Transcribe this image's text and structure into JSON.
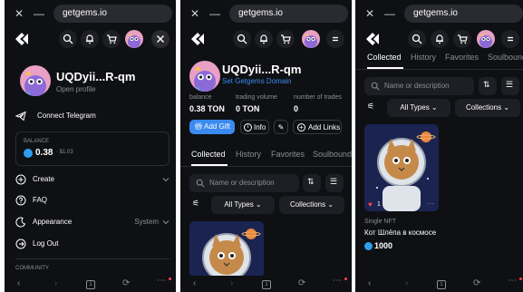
{
  "browser": {
    "url": "getgems.io"
  },
  "user": {
    "short_address": "UQDyii...R-qm",
    "open_profile": "Open profile",
    "set_domain": "Set Getgems Domain"
  },
  "menu": {
    "connect_telegram": "Connect Telegram",
    "balance_label": "BALANCE",
    "balance_value": "0.38",
    "balance_usd": "· $1.03",
    "items": [
      {
        "label": "Create",
        "icon": "plus-circle-icon"
      },
      {
        "label": "FAQ",
        "icon": "question-icon"
      },
      {
        "label": "Appearance",
        "icon": "moon-icon",
        "value": "System"
      },
      {
        "label": "Log Out",
        "icon": "logout-icon"
      }
    ],
    "community_label": "COMMUNITY"
  },
  "profile": {
    "stats": [
      {
        "label": "balance",
        "value": "0.38 TON"
      },
      {
        "label": "trading volume",
        "value": "0 TON"
      },
      {
        "label": "number of trades",
        "value": "0"
      }
    ],
    "actions": {
      "add_gift": "Add Gift",
      "info": "Info",
      "add_links": "Add Links"
    }
  },
  "tabs": [
    "Collected",
    "History",
    "Favorites",
    "Soulbounds"
  ],
  "tabs_p3": [
    "Collected",
    "History",
    "Favorites",
    "Soulbound"
  ],
  "filters": {
    "search_placeholder": "Name or description",
    "all_types": "All Types",
    "collections": "Collections"
  },
  "nft": {
    "likes": "1",
    "kind": "Single NFT",
    "name": "Кот Шлёпа в космосе",
    "price": "1000"
  },
  "colors": {
    "accent": "#3a8af0",
    "background": "#0f1013",
    "surface": "#1e1f24",
    "ton": "#2e9ff0"
  },
  "bottom_bar": {
    "tab_count": "1"
  }
}
